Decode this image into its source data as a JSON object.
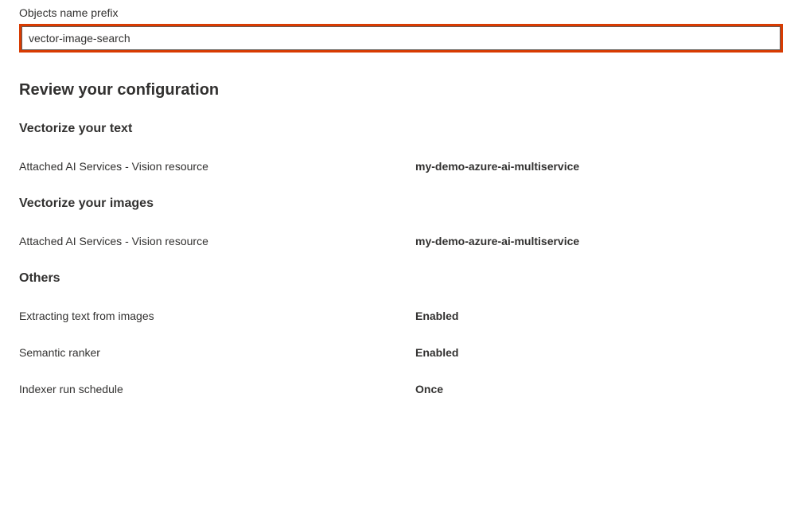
{
  "prefix": {
    "label": "Objects name prefix",
    "value": "vector-image-search"
  },
  "review": {
    "heading": "Review your configuration"
  },
  "sections": {
    "vectorize_text": {
      "heading": "Vectorize your text",
      "rows": [
        {
          "label": "Attached AI Services - Vision resource",
          "value": "my-demo-azure-ai-multiservice"
        }
      ]
    },
    "vectorize_images": {
      "heading": "Vectorize your images",
      "rows": [
        {
          "label": "Attached AI Services - Vision resource",
          "value": "my-demo-azure-ai-multiservice"
        }
      ]
    },
    "others": {
      "heading": "Others",
      "rows": [
        {
          "label": "Extracting text from images",
          "value": "Enabled"
        },
        {
          "label": "Semantic ranker",
          "value": "Enabled"
        },
        {
          "label": "Indexer run schedule",
          "value": "Once"
        }
      ]
    }
  }
}
